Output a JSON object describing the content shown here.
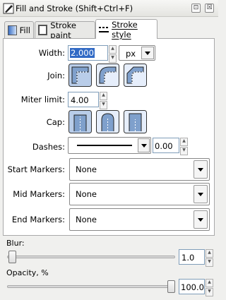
{
  "window": {
    "title": "Fill and Stroke (Shift+Ctrl+F)",
    "controls": [
      "⊡",
      "☒"
    ]
  },
  "tabs": [
    {
      "label": "Fill",
      "icon": "fill-swatch-icon",
      "active": false
    },
    {
      "label": "Stroke paint",
      "icon": "stroke-paint-icon",
      "active": false
    },
    {
      "label": "Stroke style",
      "icon": "dashed-lines-icon",
      "active": true
    }
  ],
  "stroke_style": {
    "width_label": "Width:",
    "width_value": "2.000",
    "unit_value": "px",
    "join_label": "Join:",
    "miter_label": "Miter limit:",
    "miter_value": "4.00",
    "cap_label": "Cap:",
    "dashes_label": "Dashes:",
    "dash_offset": "0.00",
    "start_markers_label": "Start Markers:",
    "start_markers_value": "None",
    "mid_markers_label": "Mid Markers:",
    "mid_markers_value": "None",
    "end_markers_label": "End Markers:",
    "end_markers_value": "None"
  },
  "blur": {
    "label": "Blur:",
    "value": "1.0",
    "level": 0.01
  },
  "opacity": {
    "label": "Opacity, %",
    "value": "100.0",
    "level": 1.0
  },
  "colors": {
    "selected_btn": "#b9cde9",
    "highlight": "#316ac5"
  }
}
